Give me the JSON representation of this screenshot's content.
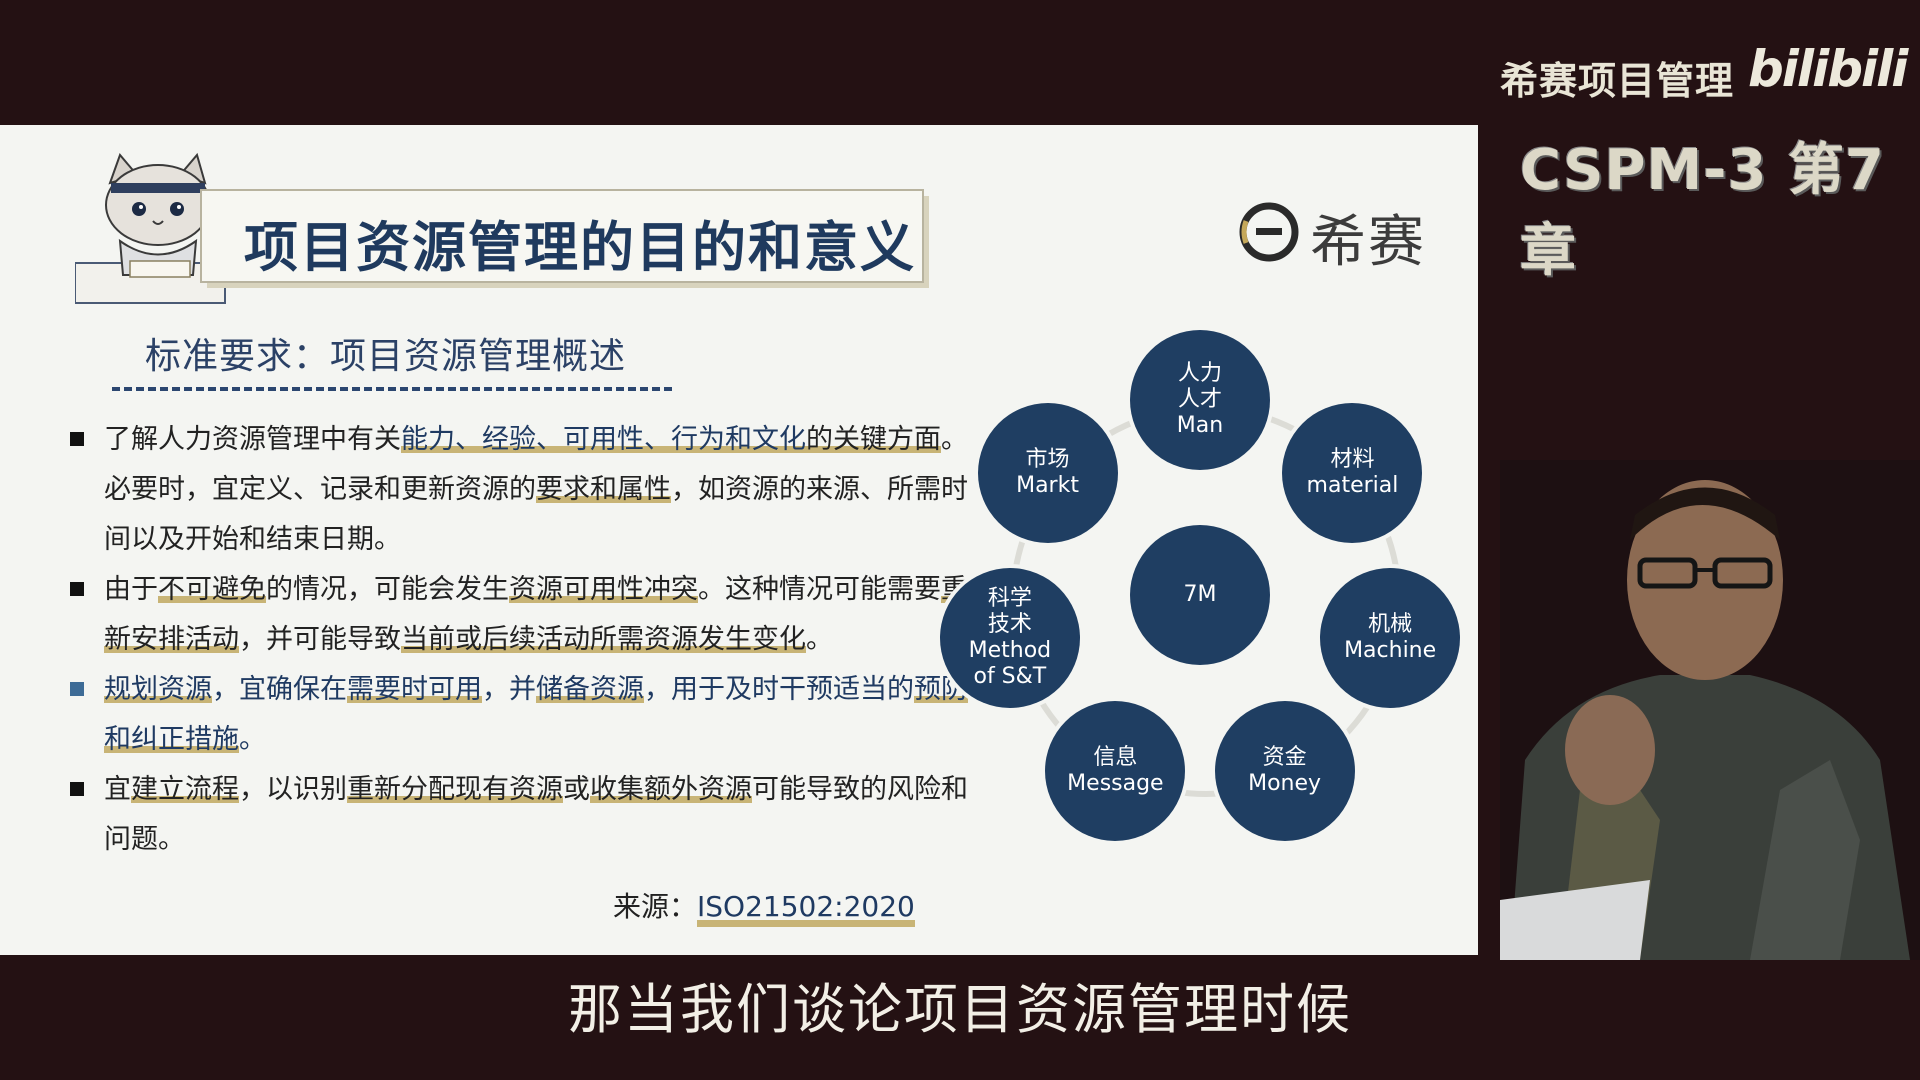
{
  "header": {
    "brand": "希赛项目管理",
    "platform_logo": "bilibili",
    "course_tag": "CSPM-3 第7章"
  },
  "slide": {
    "title": "项目资源管理的目的和意义",
    "logo_text": "希赛",
    "subtitle": "标准要求：项目资源管理概述",
    "bullets": [
      {
        "segments": [
          {
            "text": "了解人力资源管理中有关"
          },
          {
            "text": "能力、经验、可用性、行为和文化",
            "style": "blue-u"
          },
          {
            "text": "的关键方面",
            "style": "u"
          },
          {
            "text": "。必要时，宜定义、记录和更新资源的"
          },
          {
            "text": "要求和属性",
            "style": "u"
          },
          {
            "text": "，如资源的来源、所需时间以及开始和结束日期。"
          }
        ]
      },
      {
        "segments": [
          {
            "text": "由于"
          },
          {
            "text": "不可避免",
            "style": "u"
          },
          {
            "text": "的情况，可能会发生"
          },
          {
            "text": "资源可用性冲突",
            "style": "u"
          },
          {
            "text": "。这种情况可能需要"
          },
          {
            "text": "重新安排活动",
            "style": "u"
          },
          {
            "text": "，并可能导致"
          },
          {
            "text": "当前或后续活动所需资源发生变化",
            "style": "u"
          },
          {
            "text": "。"
          }
        ]
      },
      {
        "blue": true,
        "segments": [
          {
            "text": "规划资源",
            "style": "u"
          },
          {
            "text": "，宜确保在"
          },
          {
            "text": "需要时可用",
            "style": "u"
          },
          {
            "text": "，并"
          },
          {
            "text": "储备资源",
            "style": "u"
          },
          {
            "text": "，用于及时干预适当的"
          },
          {
            "text": "预防和纠正措施",
            "style": "u"
          },
          {
            "text": "。"
          }
        ]
      },
      {
        "segments": [
          {
            "text": "宜"
          },
          {
            "text": "建立流程",
            "style": "u"
          },
          {
            "text": "，以识别"
          },
          {
            "text": "重新分配现有资源",
            "style": "u"
          },
          {
            "text": "或"
          },
          {
            "text": "收集额外资源",
            "style": "u"
          },
          {
            "text": "可能导致的风险和问题。"
          }
        ]
      }
    ],
    "source_label": "来源：",
    "source_value": "ISO21502:2020"
  },
  "diagram": {
    "center": "7M",
    "nodes": [
      {
        "lines": [
          "人力",
          "人才",
          "Man"
        ]
      },
      {
        "lines": [
          "材料",
          "material"
        ]
      },
      {
        "lines": [
          "机械",
          "Machine"
        ]
      },
      {
        "lines": [
          "资金",
          "Money"
        ]
      },
      {
        "lines": [
          "信息",
          "Message"
        ]
      },
      {
        "lines": [
          "科学",
          "技术",
          "Method",
          "of S&T"
        ]
      },
      {
        "lines": [
          "市场",
          "Markt"
        ]
      }
    ],
    "node_color": "#1f3e62"
  },
  "caption": "那当我们谈论项目资源管理时候",
  "colors": {
    "background": "#241113",
    "slide_bg": "#f4f5f2",
    "title": "#1f3a5e",
    "underline": "#c8b476"
  }
}
